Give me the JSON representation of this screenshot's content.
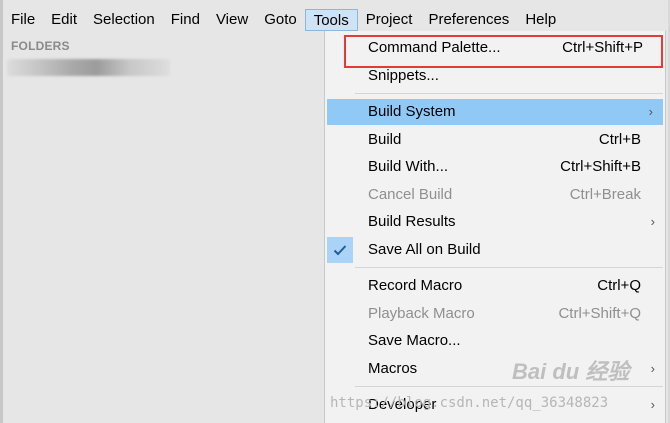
{
  "menubar": {
    "items": [
      "File",
      "Edit",
      "Selection",
      "Find",
      "View",
      "Goto",
      "Tools",
      "Project",
      "Preferences",
      "Help"
    ]
  },
  "sidebar": {
    "title": "FOLDERS"
  },
  "tools_menu": {
    "command_palette": {
      "label": "Command Palette...",
      "shortcut": "Ctrl+Shift+P"
    },
    "snippets": {
      "label": "Snippets..."
    },
    "build_system": {
      "label": "Build System",
      "arrow": "›"
    },
    "build": {
      "label": "Build",
      "shortcut": "Ctrl+B"
    },
    "build_with": {
      "label": "Build With...",
      "shortcut": "Ctrl+Shift+B"
    },
    "cancel_build": {
      "label": "Cancel Build",
      "shortcut": "Ctrl+Break"
    },
    "build_results": {
      "label": "Build Results",
      "arrow": "›"
    },
    "save_all_on_build": {
      "label": "Save All on Build"
    },
    "record_macro": {
      "label": "Record Macro",
      "shortcut": "Ctrl+Q"
    },
    "playback_macro": {
      "label": "Playback Macro",
      "shortcut": "Ctrl+Shift+Q"
    },
    "save_macro": {
      "label": "Save Macro..."
    },
    "macros": {
      "label": "Macros",
      "arrow": "›"
    },
    "developer": {
      "label": "Developer",
      "arrow": "›"
    }
  },
  "watermark": {
    "text": "https://blog.csdn.net/qq_36348823",
    "brand": "Bai du 经验"
  },
  "colors": {
    "highlight": "#90c8f6",
    "annotation_box": "#e53a3a",
    "menu_bg": "#f2f2f2"
  }
}
